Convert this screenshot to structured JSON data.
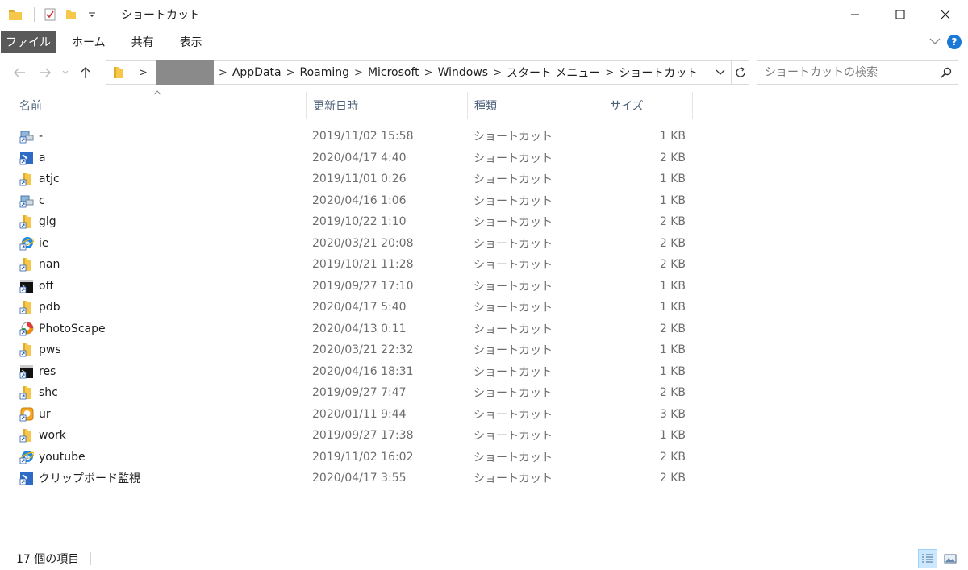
{
  "window": {
    "title": "ショートカット"
  },
  "ribbon": {
    "tabs": [
      "ファイル",
      "ホーム",
      "共有",
      "表示"
    ]
  },
  "address": {
    "crumbs": [
      "AppData",
      "Roaming",
      "Microsoft",
      "Windows",
      "スタート メニュー",
      "ショートカット"
    ]
  },
  "search": {
    "placeholder": "ショートカットの検索"
  },
  "columns": {
    "name": "名前",
    "date": "更新日時",
    "type": "種類",
    "size": "サイズ"
  },
  "files": [
    {
      "name": "-",
      "date": "2019/11/02 15:58",
      "type": "ショートカット",
      "size": "1 KB",
      "icon": "network-shortcut-icon"
    },
    {
      "name": "a",
      "date": "2020/04/17 4:40",
      "type": "ショートカット",
      "size": "2 KB",
      "icon": "powershell-shortcut-icon"
    },
    {
      "name": "atjc",
      "date": "2019/11/01 0:26",
      "type": "ショートカット",
      "size": "1 KB",
      "icon": "folder-shortcut-icon"
    },
    {
      "name": "c",
      "date": "2020/04/16 1:06",
      "type": "ショートカット",
      "size": "1 KB",
      "icon": "network-shortcut-icon"
    },
    {
      "name": "glg",
      "date": "2019/10/22 1:10",
      "type": "ショートカット",
      "size": "2 KB",
      "icon": "folder-shortcut-icon"
    },
    {
      "name": "ie",
      "date": "2020/03/21 20:08",
      "type": "ショートカット",
      "size": "2 KB",
      "icon": "ie-shortcut-icon"
    },
    {
      "name": "nan",
      "date": "2019/10/21 11:28",
      "type": "ショートカット",
      "size": "2 KB",
      "icon": "folder-shortcut-icon"
    },
    {
      "name": "off",
      "date": "2019/09/27 17:10",
      "type": "ショートカット",
      "size": "1 KB",
      "icon": "cmd-shortcut-icon"
    },
    {
      "name": "pdb",
      "date": "2020/04/17 5:40",
      "type": "ショートカット",
      "size": "1 KB",
      "icon": "folder-shortcut-icon"
    },
    {
      "name": "PhotoScape",
      "date": "2020/04/13 0:11",
      "type": "ショートカット",
      "size": "2 KB",
      "icon": "photoscape-icon"
    },
    {
      "name": "pws",
      "date": "2020/03/21 22:32",
      "type": "ショートカット",
      "size": "1 KB",
      "icon": "folder-shortcut-icon"
    },
    {
      "name": "res",
      "date": "2020/04/16 18:31",
      "type": "ショートカット",
      "size": "1 KB",
      "icon": "cmd-shortcut-icon"
    },
    {
      "name": "shc",
      "date": "2019/09/27 7:47",
      "type": "ショートカット",
      "size": "2 KB",
      "icon": "folder-shortcut-icon"
    },
    {
      "name": "ur",
      "date": "2020/01/11 9:44",
      "type": "ショートカット",
      "size": "3 KB",
      "icon": "app-shortcut-icon"
    },
    {
      "name": "work",
      "date": "2019/09/27 17:38",
      "type": "ショートカット",
      "size": "1 KB",
      "icon": "folder-shortcut-icon"
    },
    {
      "name": "youtube",
      "date": "2019/11/02 16:02",
      "type": "ショートカット",
      "size": "2 KB",
      "icon": "ie-shortcut-icon"
    },
    {
      "name": "クリップボード監視",
      "date": "2020/04/17 3:55",
      "type": "ショートカット",
      "size": "2 KB",
      "icon": "powershell-shortcut-icon"
    }
  ],
  "status": {
    "count_text": "17 個の項目"
  },
  "colors": {
    "file_tab": "#595959",
    "selected_view": "#cce8ff",
    "header_text": "#4c607a",
    "folder": "#f5c84c"
  }
}
